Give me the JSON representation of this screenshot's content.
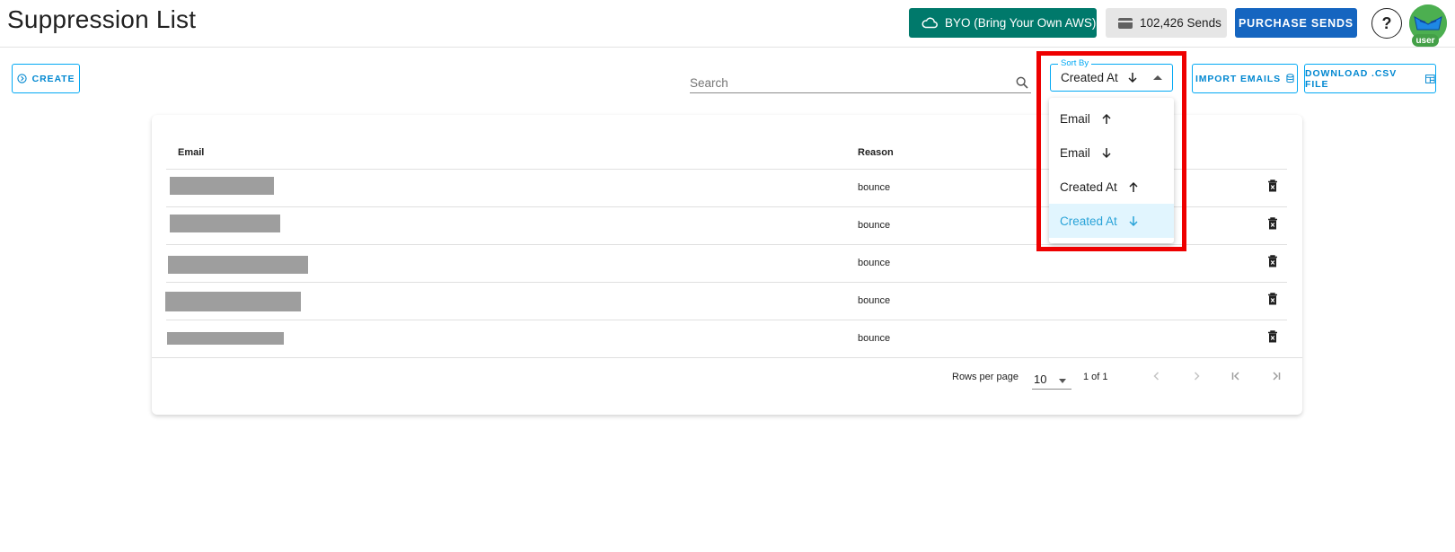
{
  "header": {
    "title": "Suppression List",
    "byo_label": "BYO (Bring Your Own AWS)",
    "sends_label": "102,426 Sends",
    "purchase_label": "PURCHASE SENDS",
    "help_label": "?",
    "avatar_badge": "user"
  },
  "toolbar": {
    "create_label": "CREATE",
    "search_placeholder": "Search",
    "sort_by_label": "Sort By",
    "sort_by_value": "Created At",
    "import_label": "IMPORT EMAILS",
    "download_label": "DOWNLOAD .CSV FILE"
  },
  "sort_menu": {
    "items": [
      {
        "label": "Email",
        "direction": "up"
      },
      {
        "label": "Email",
        "direction": "down"
      },
      {
        "label": "Created At",
        "direction": "up"
      },
      {
        "label": "Created At",
        "direction": "down",
        "selected": true
      }
    ]
  },
  "table": {
    "columns": [
      "Email",
      "Reason"
    ],
    "rows": [
      {
        "reason": "bounce"
      },
      {
        "reason": "bounce"
      },
      {
        "reason": "bounce"
      },
      {
        "reason": "bounce"
      },
      {
        "reason": "bounce"
      }
    ]
  },
  "pagination": {
    "rows_per_page_label": "Rows per page",
    "rows_per_page": "10",
    "range": "1 of 1"
  },
  "colors": {
    "byo_bg": "#00796b",
    "purchase_bg": "#1565c0",
    "accent": "#03a9f4",
    "highlight": "#ee0000"
  }
}
